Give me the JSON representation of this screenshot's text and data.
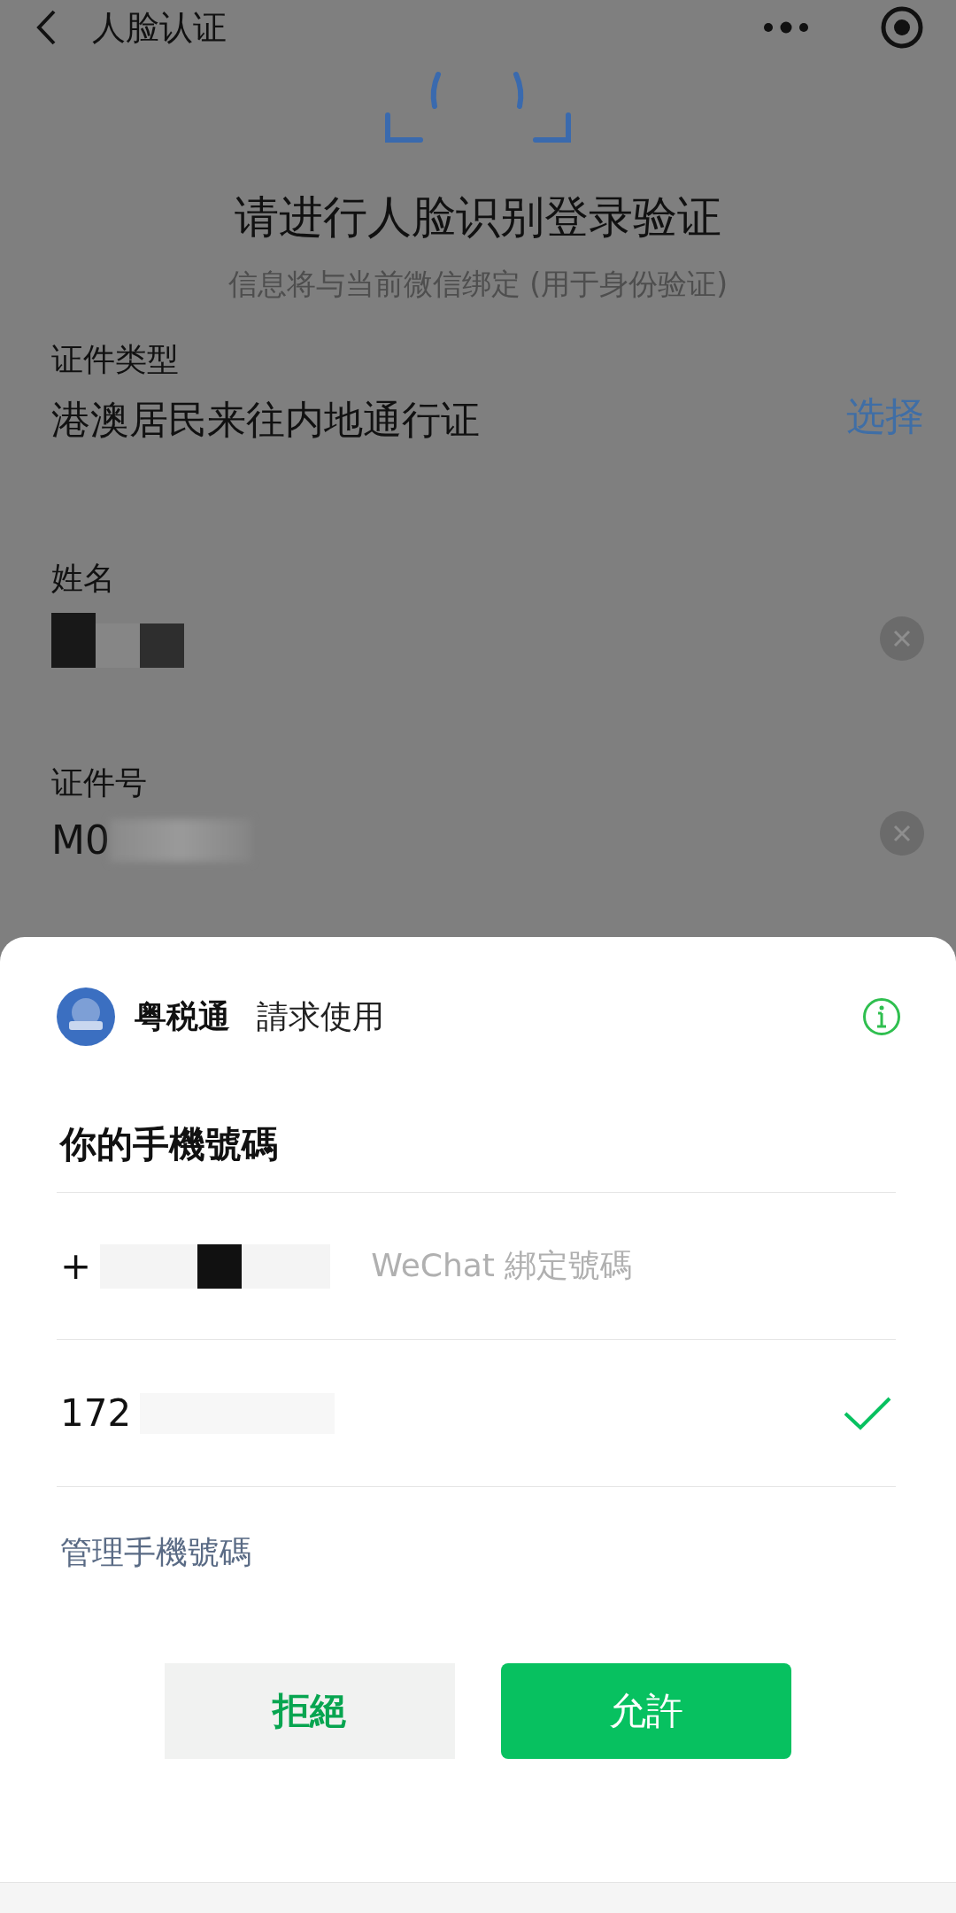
{
  "nav": {
    "title": "人脸认证"
  },
  "page": {
    "heading": "请进行人脸识别登录验证",
    "subtitle": "信息将与当前微信绑定 (用于身份验证)",
    "fields": [
      {
        "kind": "select",
        "label": "证件类型",
        "value": "港澳居民来往内地通行证",
        "action": "选择"
      },
      {
        "kind": "mosaic",
        "label": "姓名"
      },
      {
        "kind": "text",
        "label": "证件号",
        "value": "M0"
      }
    ]
  },
  "sheet": {
    "app_name": "粤税通",
    "request": "請求使用",
    "title": "你的手機號碼",
    "phones": [
      {
        "prefix": "+",
        "note": "WeChat 綁定號碼",
        "selected": false
      },
      {
        "prefix": "172",
        "selected": true
      }
    ],
    "manage_link": "管理手機號碼",
    "buttons": [
      {
        "label": "拒絕",
        "kind": "secondary"
      },
      {
        "label": "允許",
        "kind": "primary"
      }
    ]
  }
}
